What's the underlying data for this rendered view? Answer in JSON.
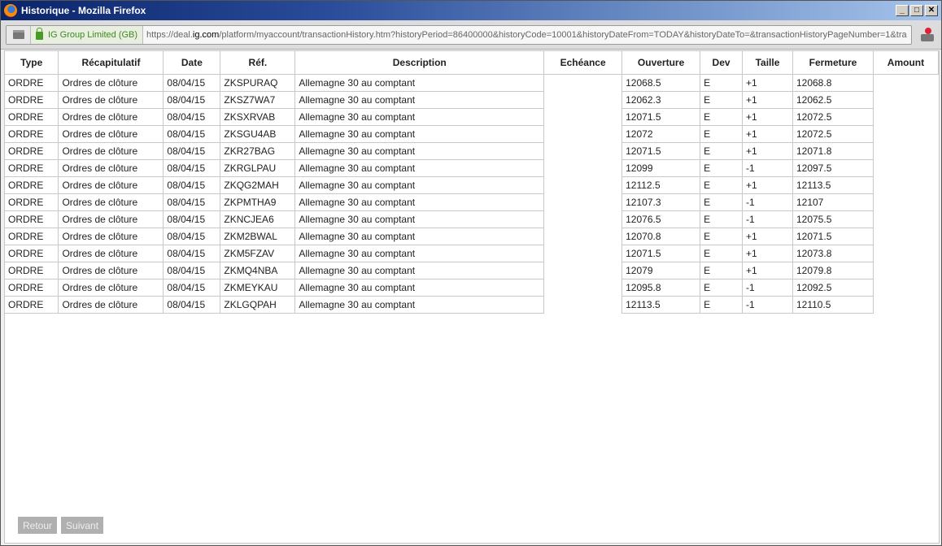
{
  "window": {
    "title": "Historique - Mozilla Firefox",
    "min": "_",
    "max": "□",
    "close": "✕"
  },
  "urlbar": {
    "identity": "IG Group Limited (GB)",
    "url_prefix": "https://deal.",
    "url_domain": "ig.com",
    "url_rest": "/platform/myaccount/transactionHistory.htm?historyPeriod=86400000&historyCode=10001&historyDateFrom=TODAY&historyDateTo=&transactionHistoryPageNumber=1&tra"
  },
  "table": {
    "headers": [
      "Type",
      "Récapitulatif",
      "Date",
      "Réf.",
      "Description",
      "Echéance",
      "Ouverture",
      "Dev",
      "Taille",
      "Fermeture",
      "Amount"
    ],
    "rows": [
      {
        "type": "ORDRE",
        "recap": "Ordres de clôture",
        "date": "08/04/15",
        "ref": "ZKSPURAQ",
        "desc": "Allemagne 30 au comptant",
        "ech": "",
        "ouv": "12068.5",
        "dev": "E",
        "taille": "+1",
        "ferm": "12068.8",
        "amount": ""
      },
      {
        "type": "ORDRE",
        "recap": "Ordres de clôture",
        "date": "08/04/15",
        "ref": "ZKSZ7WA7",
        "desc": "Allemagne 30 au comptant",
        "ech": "",
        "ouv": "12062.3",
        "dev": "E",
        "taille": "+1",
        "ferm": "12062.5",
        "amount": ""
      },
      {
        "type": "ORDRE",
        "recap": "Ordres de clôture",
        "date": "08/04/15",
        "ref": "ZKSXRVAB",
        "desc": "Allemagne 30 au comptant",
        "ech": "",
        "ouv": "12071.5",
        "dev": "E",
        "taille": "+1",
        "ferm": "12072.5",
        "amount": ""
      },
      {
        "type": "ORDRE",
        "recap": "Ordres de clôture",
        "date": "08/04/15",
        "ref": "ZKSGU4AB",
        "desc": "Allemagne 30 au comptant",
        "ech": "",
        "ouv": "12072",
        "dev": "E",
        "taille": "+1",
        "ferm": "12072.5",
        "amount": ""
      },
      {
        "type": "ORDRE",
        "recap": "Ordres de clôture",
        "date": "08/04/15",
        "ref": "ZKR27BAG",
        "desc": "Allemagne 30 au comptant",
        "ech": "",
        "ouv": "12071.5",
        "dev": "E",
        "taille": "+1",
        "ferm": "12071.8",
        "amount": ""
      },
      {
        "type": "ORDRE",
        "recap": "Ordres de clôture",
        "date": "08/04/15",
        "ref": "ZKRGLPAU",
        "desc": "Allemagne 30 au comptant",
        "ech": "",
        "ouv": "12099",
        "dev": "E",
        "taille": "-1",
        "ferm": "12097.5",
        "amount": ""
      },
      {
        "type": "ORDRE",
        "recap": "Ordres de clôture",
        "date": "08/04/15",
        "ref": "ZKQG2MAH",
        "desc": "Allemagne 30 au comptant",
        "ech": "",
        "ouv": "12112.5",
        "dev": "E",
        "taille": "+1",
        "ferm": "12113.5",
        "amount": ""
      },
      {
        "type": "ORDRE",
        "recap": "Ordres de clôture",
        "date": "08/04/15",
        "ref": "ZKPMTHA9",
        "desc": "Allemagne 30 au comptant",
        "ech": "",
        "ouv": "12107.3",
        "dev": "E",
        "taille": "-1",
        "ferm": "12107",
        "amount": ""
      },
      {
        "type": "ORDRE",
        "recap": "Ordres de clôture",
        "date": "08/04/15",
        "ref": "ZKNCJEA6",
        "desc": "Allemagne 30 au comptant",
        "ech": "",
        "ouv": "12076.5",
        "dev": "E",
        "taille": "-1",
        "ferm": "12075.5",
        "amount": ""
      },
      {
        "type": "ORDRE",
        "recap": "Ordres de clôture",
        "date": "08/04/15",
        "ref": "ZKM2BWAL",
        "desc": "Allemagne 30 au comptant",
        "ech": "",
        "ouv": "12070.8",
        "dev": "E",
        "taille": "+1",
        "ferm": "12071.5",
        "amount": ""
      },
      {
        "type": "ORDRE",
        "recap": "Ordres de clôture",
        "date": "08/04/15",
        "ref": "ZKM5FZAV",
        "desc": "Allemagne 30 au comptant",
        "ech": "",
        "ouv": "12071.5",
        "dev": "E",
        "taille": "+1",
        "ferm": "12073.8",
        "amount": ""
      },
      {
        "type": "ORDRE",
        "recap": "Ordres de clôture",
        "date": "08/04/15",
        "ref": "ZKMQ4NBA",
        "desc": "Allemagne 30 au comptant",
        "ech": "",
        "ouv": "12079",
        "dev": "E",
        "taille": "+1",
        "ferm": "12079.8",
        "amount": ""
      },
      {
        "type": "ORDRE",
        "recap": "Ordres de clôture",
        "date": "08/04/15",
        "ref": "ZKMEYKAU",
        "desc": "Allemagne 30 au comptant",
        "ech": "",
        "ouv": "12095.8",
        "dev": "E",
        "taille": "-1",
        "ferm": "12092.5",
        "amount": ""
      },
      {
        "type": "ORDRE",
        "recap": "Ordres de clôture",
        "date": "08/04/15",
        "ref": "ZKLGQPAH",
        "desc": "Allemagne 30 au comptant",
        "ech": "",
        "ouv": "12113.5",
        "dev": "E",
        "taille": "-1",
        "ferm": "12110.5",
        "amount": ""
      }
    ]
  },
  "pager": {
    "back": "Retour",
    "next": "Suivant"
  }
}
